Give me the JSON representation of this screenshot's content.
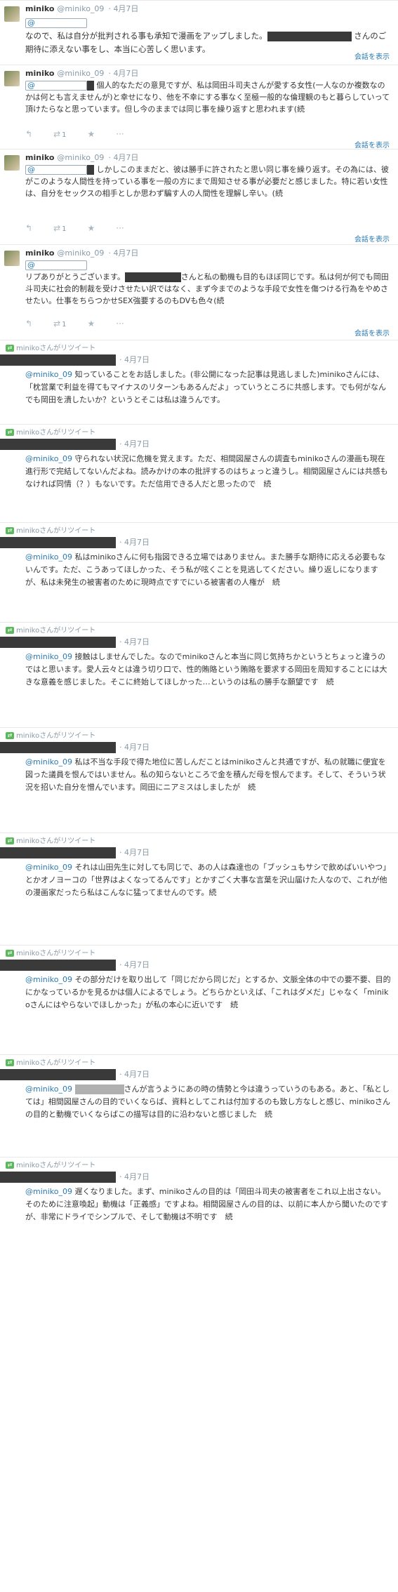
{
  "tweets": [
    {
      "type": "own",
      "name": "miniko",
      "handle": "@miniko_09",
      "time": "4月7日",
      "mention": "@",
      "text_a": "なので、私は自分が批判される事も承知で漫画をアップしました。",
      "text_b": "さんのご期待に添えない事をし、本当に心苦しく思います。",
      "show": "会話を表示"
    },
    {
      "type": "own",
      "name": "miniko",
      "handle": "@miniko_09",
      "time": "4月7日",
      "mention": "@",
      "text_a": "個人的なただの意見ですが、私は岡田斗司夫さんが愛する女性(一人なのか複数なのかは何とも言えませんが)と幸せになり、他を不幸にする事なく至極一般的な倫理観のもと暮らしていって頂けたらなと思っています。但し今のままでは同じ事を繰り返すと思われます(続",
      "rt_count": "1",
      "show": "会話を表示"
    },
    {
      "type": "own",
      "name": "miniko",
      "handle": "@miniko_09",
      "time": "4月7日",
      "mention": "@",
      "text_a": "しかしこのままだと、彼は勝手に許されたと思い同じ事を繰り返す。その為には、彼がこのような人間性を持っている事を一般の方にまで周知させる事が必要だと感じました。特に若い女性は、自分をセックスの相手としか思わず騙す人の人間性を理解し辛い。(続",
      "rt_count": "1",
      "show": "会話を表示"
    },
    {
      "type": "own",
      "name": "miniko",
      "handle": "@miniko_09",
      "time": "4月7日",
      "mention": "@",
      "text_a": "リプありがとうございます。",
      "text_b": "さんと私の動機も目的もほぼ同じです。私は何が何でも岡田斗司夫に社会的制裁を受けさせたい訳ではなく、まず今までのような手段で女性を傷つける行為をやめさせたい。仕事をちらつかせSEX強要するのもDVも色々(続",
      "rt_count": "1",
      "show": "会話を表示"
    },
    {
      "type": "rt",
      "rt_label": "minikoさんがリツイート",
      "time": "4月7日",
      "mention": "@miniko_09",
      "text_a": "知っていることをお話しました。(非公開になった記事は見逃しました)minikoさんには、「枕営業で利益を得てもマイナスのリターンもあるんだよ」っていうところに共感します。でも何がなんでも岡田を潰したいか？というとそこは私は違うんです。"
    },
    {
      "type": "rt",
      "rt_label": "minikoさんがリツイート",
      "time": "4月7日",
      "mention": "@miniko_09",
      "text_a": "守られない状況に危機を覚えます。ただ、相間図屋さんの調査もminikoさんの漫画も現在進行形で完結してないんだよね。読みかけの本の批評するのはちょっと違うし。相間図屋さんには共感もなければ同情（？）もないです。ただ信用できる人だと思ったので　続"
    },
    {
      "type": "rt",
      "rt_label": "minikoさんがリツイート",
      "time": "4月7日",
      "mention": "@miniko_09",
      "text_a": "私はminikoさんに何も指図できる立場ではありません。また勝手な期待に応える必要もないんです。ただ、こうあってほしかった、そう私が呟くことを見逃してください。繰り返しになりますが、私は未発生の被害者のために現時点ですでにいる被害者の人権が　続"
    },
    {
      "type": "rt",
      "rt_label": "minikoさんがリツイート",
      "time": "4月7日",
      "mention": "@miniko_09",
      "text_a": "接触はしませんでした。なのでminikoさんと本当に同じ気持ちかというとちょっと違うのではと思います。愛人云々とは違う切り口で、性的賄賂という賄賂を要求する岡田を周知することには大きな意義を感じました。そこに終始してほしかった…というのは私の勝手な願望です　続"
    },
    {
      "type": "rt",
      "rt_label": "minikoさんがリツイート",
      "time": "4月7日",
      "mention": "@miniko_09",
      "text_a": "私は不当な手段で得た地位に苦しんだことはminikoさんと共通ですが、私の就職に便宜を図った議員を恨んではいません。私の知らないところで金を積んだ母を恨んでます。そして、そういう状況を招いた自分を憎んでいます。岡田にニアミスはしましたが　続"
    },
    {
      "type": "rt",
      "rt_label": "minikoさんがリツイート",
      "time": "4月7日",
      "mention": "@miniko_09",
      "text_a": "それは山田先生に対しても同じで、あの人は森達也の「ブッシュもサシで飲めばいいやつ」とかオノヨーコの「世界はよくなってるんです」とかすごく大事な言葉を沢山届けた人なので、これが他の漫画家だったら私はこんなに猛ってませんのです。続"
    },
    {
      "type": "rt",
      "rt_label": "minikoさんがリツイート",
      "time": "4月7日",
      "mention": "@miniko_09",
      "text_a": "その部分だけを取り出して「同じだから同じだ」とするか、文脈全体の中での要不要、目的にかなっているかを見るかは個人によるでしょう。どちらかといえば、「これはダメだ」じゃなく「minikoさんにはやらないでほしかった」が私の本心に近いです　続"
    },
    {
      "type": "rt",
      "rt_label": "minikoさんがリツイート",
      "time": "4月7日",
      "mention": "@miniko_09",
      "text_a": "さんが言うようにあの時の情勢と今は違うっていうのもある。あと、「私としては」相間図屋さんの目的でいくならば、資料としてこれは付加するのも致し方なしと感じ、minikoさんの目的と動機でいくならばこの描写は目的に沿わないと感じました　続"
    },
    {
      "type": "rt",
      "rt_label": "minikoさんがリツイート",
      "time": "4月7日",
      "mention": "@miniko_09",
      "text_a": "遅くなりました。まず、minikoさんの目的は「岡田斗司夫の被害者をこれ以上出さない。そのために注意喚起」動機は「正義感」ですよね。相間図屋さんの目的は、以前に本人から聞いたのですが、非常にドライでシンプルで、そして動機は不明です　続"
    }
  ]
}
